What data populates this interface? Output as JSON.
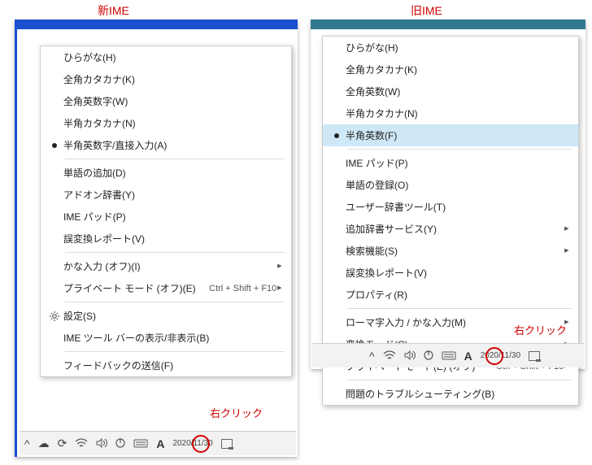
{
  "titles": {
    "new_ime": "新IME",
    "old_ime": "旧IME"
  },
  "annotations": {
    "right_click": "右クリック"
  },
  "colors": {
    "new_frame": "#1a4fcf",
    "old_frame": "#2f7a8c",
    "red": "#d00000"
  },
  "new_menu": {
    "items": [
      {
        "label": "ひらがな(H)"
      },
      {
        "label": "全角カタカナ(K)"
      },
      {
        "label": "全角英数字(W)"
      },
      {
        "label": "半角カタカナ(N)"
      },
      {
        "label": "半角英数字/直接入力(A)",
        "bullet": true
      },
      {
        "sep": true
      },
      {
        "label": "単語の追加(D)"
      },
      {
        "label": "アドオン辞書(Y)"
      },
      {
        "label": "IME パッド(P)"
      },
      {
        "label": "誤変換レポート(V)"
      },
      {
        "sep": true
      },
      {
        "label": "かな入力 (オフ)(I)",
        "submenu": true
      },
      {
        "label": "プライベート モード (オフ)(E)",
        "hint": "Ctrl + Shift + F10",
        "submenu": true
      },
      {
        "sep": true
      },
      {
        "label": "設定(S)",
        "gear": true
      },
      {
        "label": "IME ツール バーの表示/非表示(B)"
      },
      {
        "sep": true
      },
      {
        "label": "フィードバックの送信(F)"
      }
    ]
  },
  "old_menu": {
    "items": [
      {
        "label": "ひらがな(H)"
      },
      {
        "label": "全角カタカナ(K)"
      },
      {
        "label": "全角英数(W)"
      },
      {
        "label": "半角カタカナ(N)"
      },
      {
        "label": "半角英数(F)",
        "bullet": true,
        "selected": true
      },
      {
        "sep": true
      },
      {
        "label": "IME パッド(P)"
      },
      {
        "label": "単語の登録(O)"
      },
      {
        "label": "ユーザー辞書ツール(T)"
      },
      {
        "label": "追加辞書サービス(Y)",
        "submenu": true
      },
      {
        "label": "検索機能(S)",
        "submenu": true
      },
      {
        "label": "誤変換レポート(V)"
      },
      {
        "label": "プロパティ(R)"
      },
      {
        "sep": true
      },
      {
        "label": "ローマ字入力 / かな入力(M)",
        "submenu": true
      },
      {
        "label": "変換モード(C)",
        "submenu": true
      },
      {
        "label": "プライベートモード(E) (オフ)",
        "hint": "Ctrl + Shift + F10",
        "submenu": true
      },
      {
        "sep": true
      },
      {
        "label": "問題のトラブルシューティング(B)"
      }
    ]
  },
  "taskbar": {
    "chevron": "^",
    "cloud": "☁",
    "sync": "⟳",
    "wifi": "⚙",
    "speaker": "🔊",
    "power": "⏻",
    "keyboard": "⌨",
    "ime_letter": "A",
    "date": "2020/11/30",
    "time_hidden": ""
  }
}
